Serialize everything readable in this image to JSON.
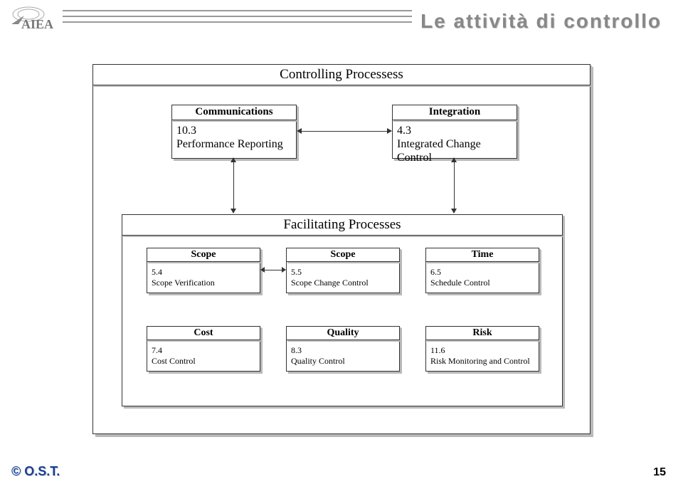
{
  "title": "Le attività di controllo",
  "outer_header": "Controlling Processess",
  "top_left": {
    "header": "Communications",
    "num": "10.3",
    "text": "Performance Reporting"
  },
  "top_right": {
    "header": "Integration",
    "num": "4.3",
    "text": "Integrated Change Control"
  },
  "inner_header": "Facilitating Processes",
  "row1": [
    {
      "header": "Scope",
      "num": "5.4",
      "text": "Scope Verification"
    },
    {
      "header": "Scope",
      "num": "5.5",
      "text": "Scope Change Control"
    },
    {
      "header": "Time",
      "num": "6.5",
      "text": "Schedule Control"
    }
  ],
  "row2": [
    {
      "header": "Cost",
      "num": "7.4",
      "text": "Cost Control"
    },
    {
      "header": "Quality",
      "num": "8.3",
      "text": "Quality Control"
    },
    {
      "header": "Risk",
      "num": "11.6",
      "text": "Risk Monitoring and Control"
    }
  ],
  "copyright": "© O.S.T.",
  "page": "15"
}
